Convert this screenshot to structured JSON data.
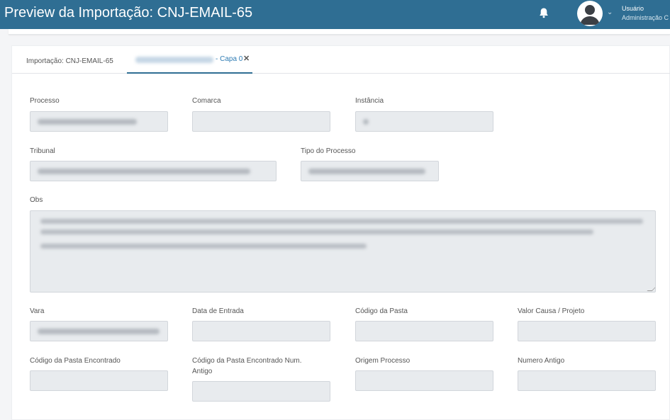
{
  "header": {
    "title": "Preview da Importação: CNJ-EMAIL-65",
    "user_name": "Usuário",
    "user_role": "Administração C"
  },
  "tabs": {
    "tab1_label": "Importação: CNJ-EMAIL-65",
    "tab2_suffix": "- Capa 0",
    "close_glyph": "✕"
  },
  "form": {
    "processo_label": "Processo",
    "comarca_label": "Comarca",
    "instancia_label": "Instância",
    "tribunal_label": "Tribunal",
    "tipo_processo_label": "Tipo do Processo",
    "obs_label": "Obs",
    "vara_label": "Vara",
    "data_entrada_label": "Data de Entrada",
    "codigo_pasta_label": "Código da Pasta",
    "valor_causa_label": "Valor Causa / Projeto",
    "codigo_pasta_encontrado_label": "Código da Pasta Encontrado",
    "codigo_pasta_encontrado_num_label_line1": "Código da Pasta Encontrado Num.",
    "codigo_pasta_encontrado_num_label_line2": "Antigo",
    "origem_processo_label": "Origem Processo",
    "numero_antigo_label": "Numero Antigo"
  },
  "colors": {
    "header_bg": "#2f6e93",
    "tab_accent": "#2f6e93",
    "link": "#2f7cb4",
    "field_bg": "#e8ebee"
  },
  "icons": [
    "bell-icon",
    "avatar-icon",
    "chevron-down-icon",
    "close-icon"
  ]
}
